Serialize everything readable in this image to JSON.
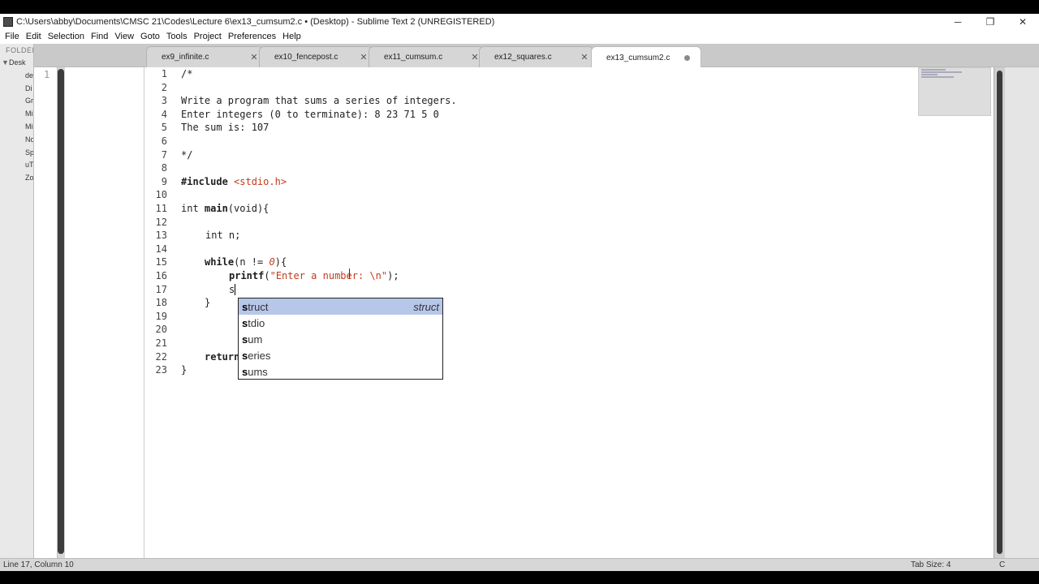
{
  "window": {
    "title": "C:\\Users\\abby\\Documents\\CMSC 21\\Codes\\Lecture 6\\ex13_cumsum2.c • (Desktop) - Sublime Text 2 (UNREGISTERED)",
    "minimize": "─",
    "maximize": "❐",
    "close": "✕"
  },
  "menu": [
    "File",
    "Edit",
    "Selection",
    "Find",
    "View",
    "Goto",
    "Tools",
    "Project",
    "Preferences",
    "Help"
  ],
  "sidebar": {
    "header": "FOLDER",
    "root": "Desk",
    "files": [
      "de",
      "Di",
      "Gr",
      "Mi",
      "Mi",
      "No",
      "Sp",
      "uT",
      "Zo"
    ]
  },
  "tabs": [
    {
      "label": "ex9_infinite.c",
      "close": "✕"
    },
    {
      "label": "ex10_fencepost.c",
      "close": "✕"
    },
    {
      "label": "ex11_cumsum.c",
      "close": "✕"
    },
    {
      "label": "ex12_squares.c",
      "close": "✕"
    },
    {
      "label": "ex13_cumsum2.c",
      "close": ""
    }
  ],
  "left_pane": {
    "line_number": "1"
  },
  "code": {
    "line_numbers": [
      "1",
      "2",
      "3",
      "4",
      "5",
      "6",
      "7",
      "8",
      "9",
      "10",
      "11",
      "12",
      "13",
      "14",
      "15",
      "16",
      "17",
      "18",
      "19",
      "20",
      "21",
      "22",
      "23"
    ],
    "l1": "/*",
    "l3": "Write a program that sums a series of integers.",
    "l4": "Enter integers (0 to terminate): 8 23 71 5 0",
    "l5": "The sum is: 107",
    "l7": "*/",
    "l9_pre": "#include",
    "l9_hdr": "<stdio.h>",
    "l11_int": "int",
    "l11_main": "main",
    "l11_rest": "(void){",
    "l13": "int n;",
    "l15_kw": "while",
    "l15_a": "(n != ",
    "l15_num": "0",
    "l15_b": "){",
    "l16_fn": "printf",
    "l16_a": "(",
    "l16_str": "\"Enter a number: \\n\"",
    "l16_b": ");",
    "l17": "s",
    "l18": "}",
    "l22": "return",
    "l23": "}"
  },
  "autocomplete": {
    "items": [
      {
        "match": "s",
        "rest": "truct",
        "hint": "struct"
      },
      {
        "match": "s",
        "rest": "tdio",
        "hint": ""
      },
      {
        "match": "s",
        "rest": "um",
        "hint": ""
      },
      {
        "match": "s",
        "rest": "eries",
        "hint": ""
      },
      {
        "match": "s",
        "rest": "ums",
        "hint": ""
      }
    ]
  },
  "status": {
    "position": "Line 17, Column 10",
    "tab_size": "Tab Size: 4",
    "syntax": "C"
  }
}
